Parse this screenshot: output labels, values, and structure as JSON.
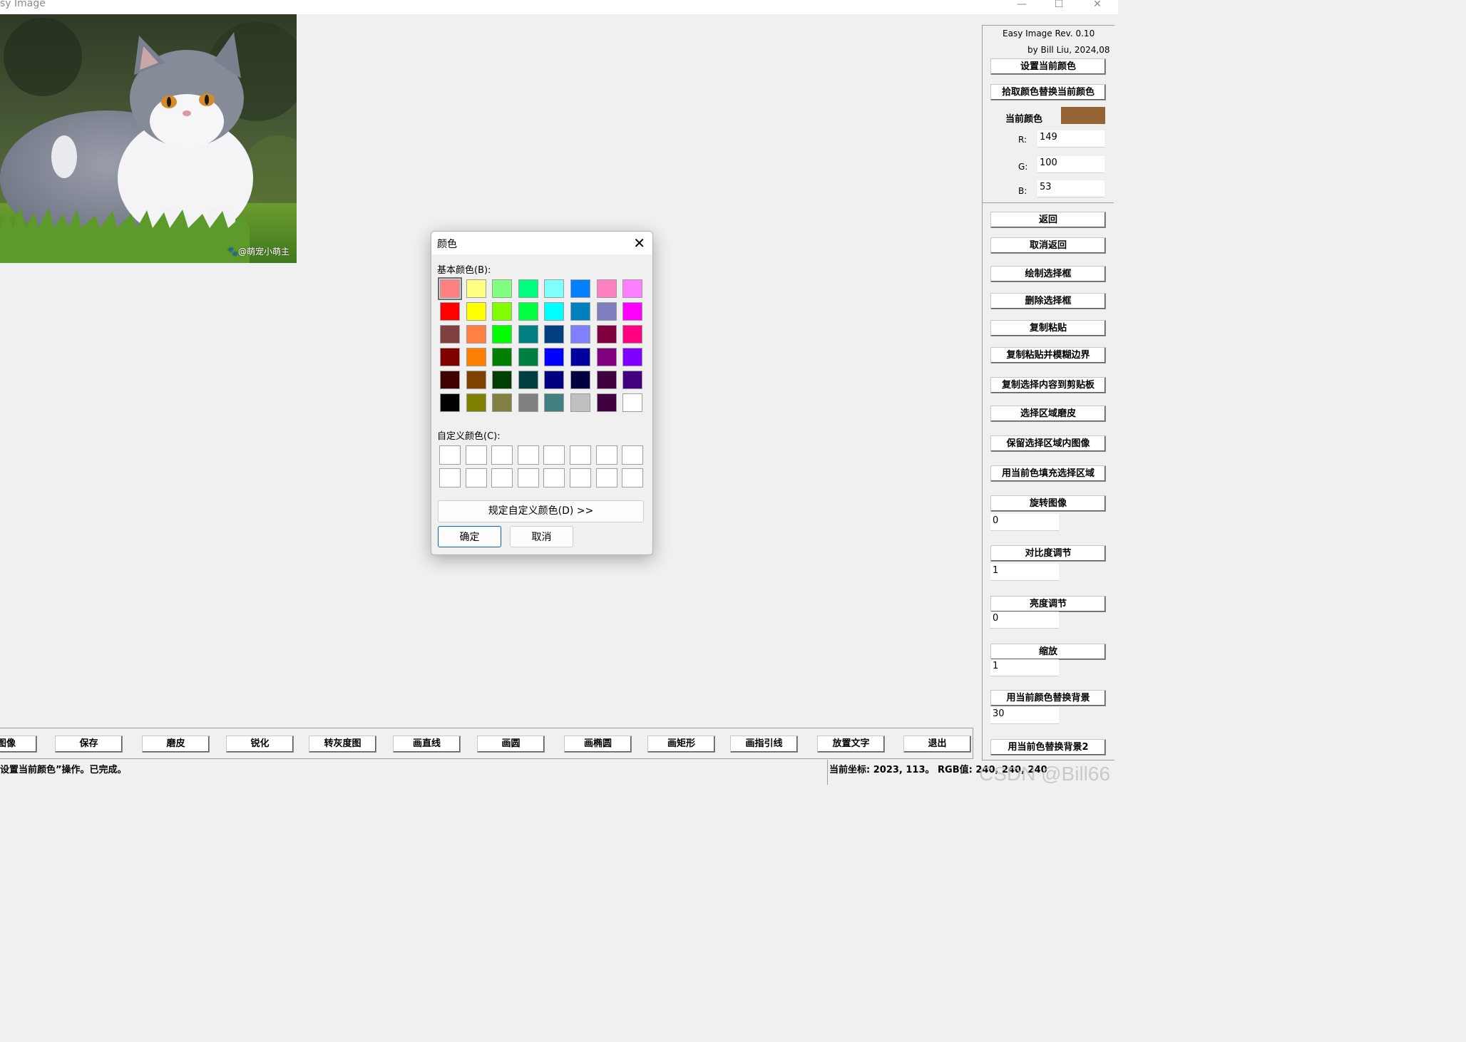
{
  "window": {
    "title": "sy Image",
    "controls": [
      "—",
      "☐",
      "✕"
    ]
  },
  "image": {
    "watermark": "🐾@萌宠小萌主"
  },
  "right_panel": {
    "app_name": "Easy Image Rev. 0.10",
    "author": "by Bill Liu, 2024,08",
    "set_current_color": "设置当前颜色",
    "pick_replace_color": "拾取颜色替换当前颜色",
    "current_color_label": "当前颜色",
    "current_color_hex": "#956435",
    "r_label": "R:",
    "r_value": "149",
    "g_label": "G:",
    "g_value": "100",
    "b_label": "B:",
    "b_value": "53",
    "undo": "返回",
    "redo": "取消返回",
    "draw_selection": "绘制选择框",
    "delete_selection": "删除选择框",
    "copy_paste": "复制粘贴",
    "copy_paste_blur": "复制粘贴并模糊边界",
    "copy_to_clipboard": "复制选择内容到剪贴板",
    "selection_smooth": "选择区域磨皮",
    "keep_selection": "保留选择区域内图像",
    "fill_selection": "用当前色填充选择区域",
    "rotate": "旋转图像",
    "rotate_value": "0",
    "contrast": "对比度调节",
    "contrast_value": "1",
    "brightness": "亮度调节",
    "brightness_value": "0",
    "zoom": "缩放",
    "zoom_value": "1",
    "replace_bg": "用当前颜色替换背景",
    "replace_bg_value": "30",
    "replace_bg2": "用当前色替换背景2"
  },
  "bottom_toolbar": [
    "打开图像",
    "保存",
    "磨皮",
    "锐化",
    "转灰度图",
    "画直线",
    "画圆",
    "画椭圆",
    "画矩形",
    "画指引线",
    "放置文字",
    "退出"
  ],
  "status": {
    "message": "设置当前颜色”操作。已完成。",
    "coords": "当前坐标: 2023, 113。 RGB值: 240, 240, 240"
  },
  "csdn_watermark": "CSDN @Bill66",
  "color_dialog": {
    "title": "颜色",
    "basic_label": "基本颜色(B):",
    "custom_label": "自定义颜色(C):",
    "define_custom": "规定自定义颜色(D) >>",
    "ok": "确定",
    "cancel": "取消",
    "basic_colors": [
      [
        "#ff8080",
        "#ffff80",
        "#80ff80",
        "#00ff80",
        "#80ffff",
        "#0080ff",
        "#ff80c0",
        "#ff80ff"
      ],
      [
        "#ff0000",
        "#ffff00",
        "#80ff00",
        "#00ff40",
        "#00ffff",
        "#0080c0",
        "#8080c0",
        "#ff00ff"
      ],
      [
        "#804040",
        "#ff8040",
        "#00ff00",
        "#008080",
        "#004080",
        "#8080ff",
        "#800040",
        "#ff0080"
      ],
      [
        "#800000",
        "#ff8000",
        "#008000",
        "#008040",
        "#0000ff",
        "#0000a0",
        "#800080",
        "#8000ff"
      ],
      [
        "#400000",
        "#804000",
        "#004000",
        "#004040",
        "#000080",
        "#000040",
        "#400040",
        "#400080"
      ],
      [
        "#000000",
        "#808000",
        "#808040",
        "#808080",
        "#408080",
        "#c0c0c0",
        "#400040",
        "#ffffff"
      ]
    ],
    "selected_index": 0
  }
}
